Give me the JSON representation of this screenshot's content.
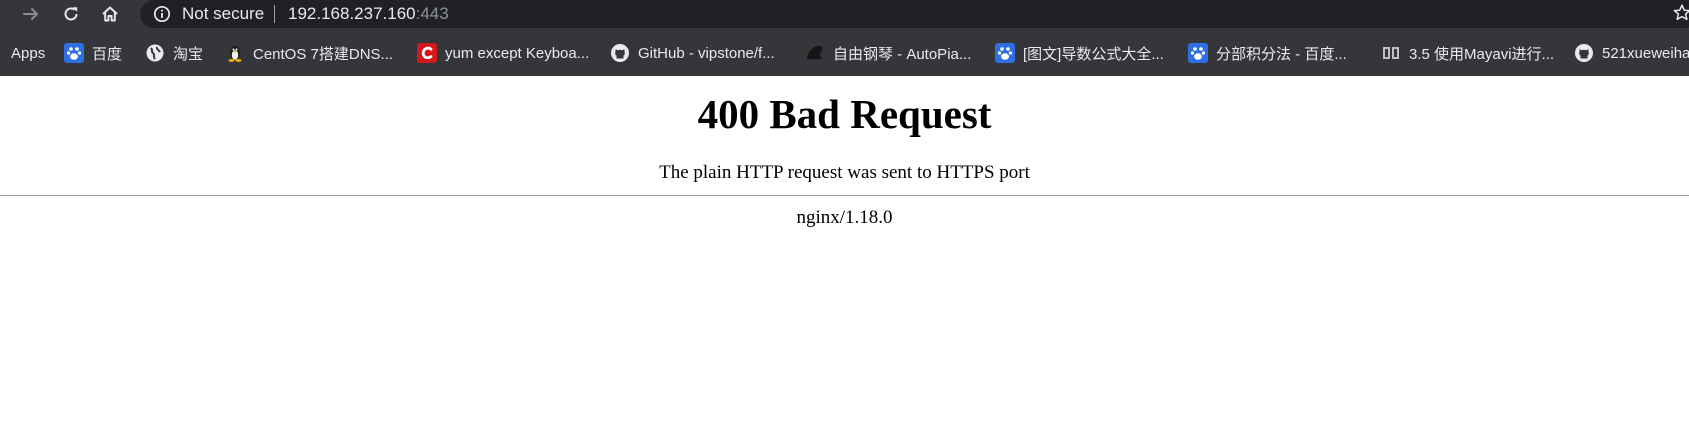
{
  "browser": {
    "toolbar": {
      "back_icon": "arrow-right-icon",
      "reload_icon": "reload-icon",
      "home_icon": "home-icon",
      "security_icon": "info-icon",
      "security_label": "Not secure",
      "url_host": "192.168.237.160",
      "url_port": ":443",
      "bookmark_star_icon": "star-icon"
    },
    "bookmarks": [
      {
        "label": "Apps",
        "icon": "apps-icon"
      },
      {
        "label": "百度",
        "icon": "baidu-paw-icon"
      },
      {
        "label": "淘宝",
        "icon": "globe-icon"
      },
      {
        "label": "CentOS 7搭建DNS...",
        "icon": "tux-icon"
      },
      {
        "label": "yum except Keyboa...",
        "icon": "csdn-icon"
      },
      {
        "label": "GitHub - vipstone/f...",
        "icon": "github-icon"
      },
      {
        "label": "自由钢琴 - AutoPia...",
        "icon": "piano-icon"
      },
      {
        "label": "[图文]导数公式大全...",
        "icon": "baidu-paw-icon"
      },
      {
        "label": "分部积分法 - 百度...",
        "icon": "baidu-paw-icon"
      },
      {
        "label": "3.5 使用Mayavi进行...",
        "icon": "book-icon"
      },
      {
        "label": "521xueweiha",
        "icon": "github-icon"
      }
    ],
    "colors": {
      "toolbar_bg": "#35363a",
      "omnibox_bg": "#202124",
      "text_light": "#e8eaed",
      "port_gray": "#8e9196"
    }
  },
  "page": {
    "heading": "400 Bad Request",
    "message": "The plain HTTP request was sent to HTTPS port",
    "server": "nginx/1.18.0"
  }
}
